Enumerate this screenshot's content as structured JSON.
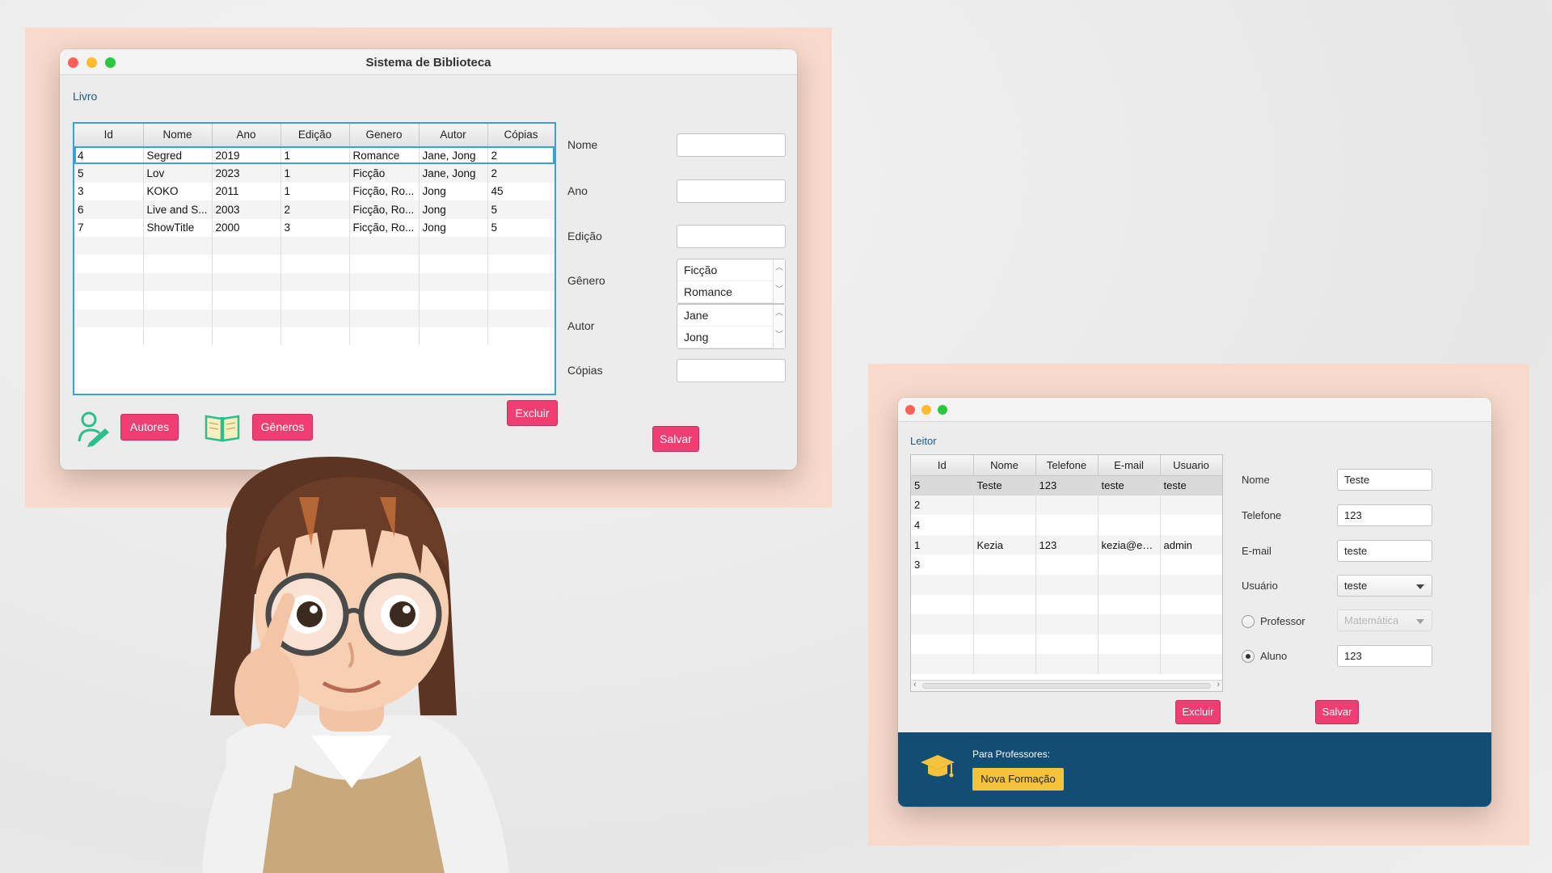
{
  "livro_window": {
    "title": "Sistema de Biblioteca",
    "section_label": "Livro",
    "table": {
      "headers": [
        "Id",
        "Nome",
        "Ano",
        "Edição",
        "Genero",
        "Autor",
        "Cópias"
      ],
      "rows": [
        [
          "4",
          "Segred",
          "2019",
          "1",
          "Romance",
          "Jane, Jong",
          "2"
        ],
        [
          "5",
          "Lov",
          "2023",
          "1",
          "Ficção",
          "Jane, Jong",
          "2"
        ],
        [
          "3",
          "KOKO",
          "2011",
          "1",
          "Ficção, Ro...",
          "Jong",
          "45"
        ],
        [
          "6",
          "Live and S...",
          "2003",
          "2",
          "Ficção, Ro...",
          "Jong",
          "5"
        ],
        [
          "7",
          "ShowTitle",
          "2000",
          "3",
          "Ficção, Ro...",
          "Jong",
          "5"
        ],
        [
          "",
          "",
          "",
          "",
          "",
          "",
          ""
        ],
        [
          "",
          "",
          "",
          "",
          "",
          "",
          ""
        ],
        [
          "",
          "",
          "",
          "",
          "",
          "",
          ""
        ],
        [
          "",
          "",
          "",
          "",
          "",
          "",
          ""
        ],
        [
          "",
          "",
          "",
          "",
          "",
          "",
          ""
        ],
        [
          "",
          "",
          "",
          "",
          "",
          "",
          ""
        ]
      ],
      "selected_row": 0
    },
    "form": {
      "nome_label": "Nome",
      "ano_label": "Ano",
      "edicao_label": "Edição",
      "genero_label": "Gênero",
      "autor_label": "Autor",
      "copias_label": "Cópias",
      "nome_value": "",
      "ano_value": "",
      "edicao_value": "",
      "copias_value": "",
      "genero_options": [
        "Ficção",
        "Romance"
      ],
      "autor_options": [
        "Jane",
        "Jong"
      ]
    },
    "buttons": {
      "excluir": "Excluir",
      "salvar": "Salvar",
      "autores": "Autores",
      "generos": "Gêneros"
    }
  },
  "leitor_window": {
    "section_label": "Leitor",
    "table": {
      "headers": [
        "Id",
        "Nome",
        "Telefone",
        "E-mail",
        "Usuario"
      ],
      "rows": [
        [
          "5",
          "Teste",
          "123",
          "teste",
          "teste"
        ],
        [
          "2",
          "",
          "",
          "",
          ""
        ],
        [
          "4",
          "",
          "",
          "",
          ""
        ],
        [
          "1",
          "Kezia",
          "123",
          "kezia@em...",
          "admin"
        ],
        [
          "3",
          "",
          "",
          "",
          ""
        ],
        [
          "",
          "",
          "",
          "",
          ""
        ],
        [
          "",
          "",
          "",
          "",
          ""
        ],
        [
          "",
          "",
          "",
          "",
          ""
        ],
        [
          "",
          "",
          "",
          "",
          ""
        ],
        [
          "",
          "",
          "",
          "",
          ""
        ]
      ],
      "selected_row": 0
    },
    "form": {
      "nome_label": "Nome",
      "nome_value": "Teste",
      "telefone_label": "Telefone",
      "telefone_value": "123",
      "email_label": "E-mail",
      "email_value": "teste",
      "usuario_label": "Usuário",
      "usuario_value": "teste",
      "professor_label": "Professor",
      "professor_combo_value": "Matemática",
      "aluno_label": "Aluno",
      "aluno_value": "123",
      "selected_radio": "Aluno"
    },
    "buttons": {
      "excluir": "Excluir",
      "salvar": "Salvar"
    },
    "footer": {
      "caption": "Para Professores:",
      "button": "Nova Formação"
    }
  },
  "colors": {
    "accent_pink": "#ef3f72",
    "panel_peach": "#f8d9cb",
    "footer_blue": "#114d74",
    "footer_button_yellow": "#f5c33b",
    "table_focus_blue": "#3aa0d8",
    "icon_teal": "#2bbf8e"
  },
  "icons": [
    "add-author-icon",
    "open-book-icon",
    "graduation-cap-icon",
    "character-illustration"
  ]
}
